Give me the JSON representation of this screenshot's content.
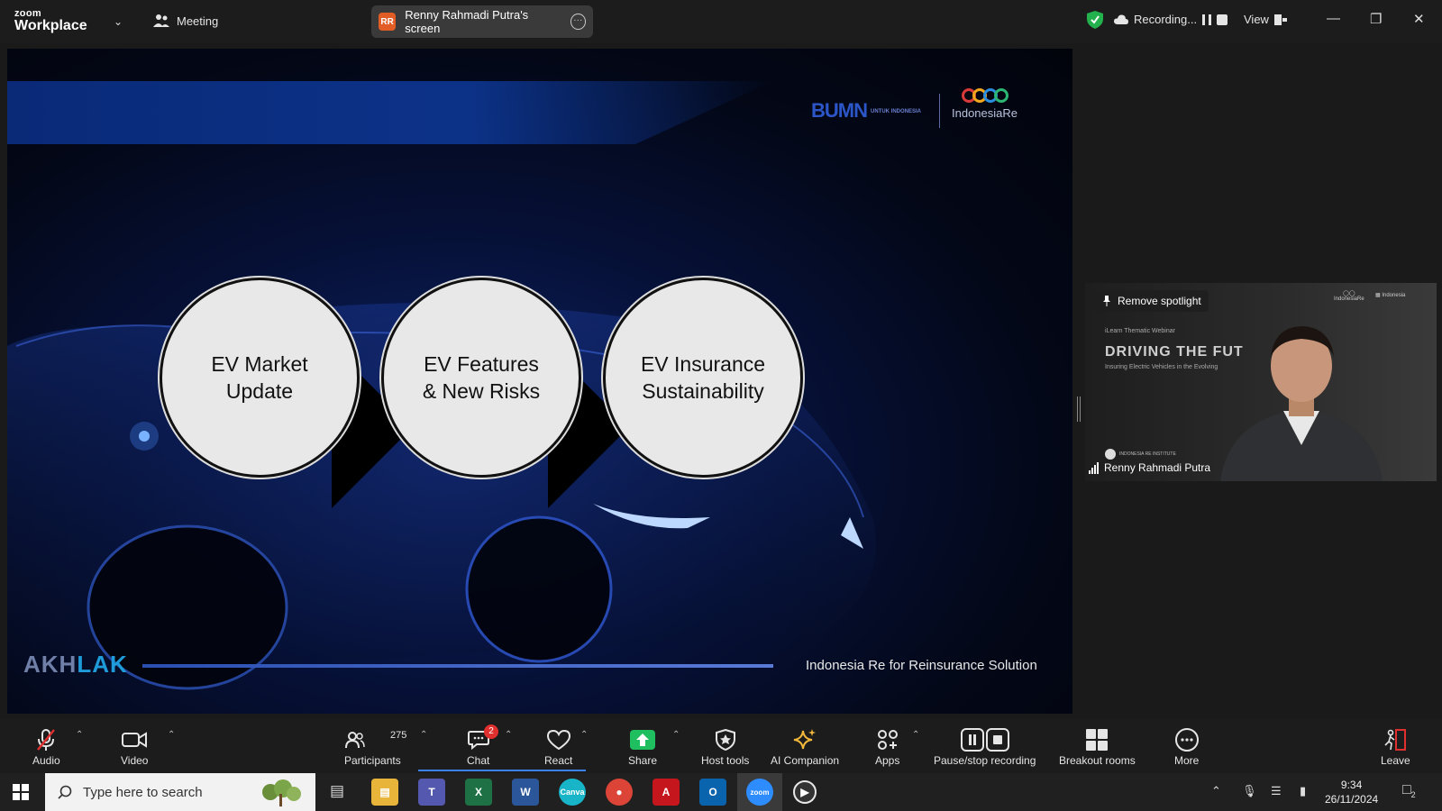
{
  "app": {
    "brand_top": "zoom",
    "brand_bottom": "Workplace",
    "meeting_label": "Meeting",
    "share_pill": {
      "initials": "RR",
      "label": "Renny Rahmadi Putra's screen"
    },
    "recording_label": "Recording...",
    "view_label": "View"
  },
  "slide": {
    "logo_bumn": "BUMN",
    "logo_bumn_sub": "UNTUK INDONESIA",
    "logo_company": "IndonesiaRe",
    "circles": [
      "EV Market\nUpdate",
      "EV Features\n& New Risks",
      "EV Insurance\nSustainability"
    ],
    "footer_logo_a": "AKH",
    "footer_logo_b": "LAK",
    "tagline": "Indonesia Re for Reinsurance Solution"
  },
  "video": {
    "spotlight_label": "Remove spotlight",
    "participant_name": "Renny Rahmadi Putra"
  },
  "toolbar": {
    "audio": "Audio",
    "video": "Video",
    "participants": "Participants",
    "participants_count": "275",
    "chat": "Chat",
    "chat_badge": "2",
    "react": "React",
    "share": "Share",
    "host_tools": "Host tools",
    "ai_companion": "AI Companion",
    "apps": "Apps",
    "pause_stop_recording": "Pause/stop recording",
    "breakout_rooms": "Breakout rooms",
    "more": "More",
    "leave": "Leave"
  },
  "taskbar": {
    "search_placeholder": "Type here to search",
    "time": "9:34",
    "date": "26/11/2024",
    "notification_count": "2"
  },
  "colors": {
    "share_green": "#1fbf5f",
    "zoom_blue": "#2d8cff",
    "badge_red": "#e02f2f"
  }
}
